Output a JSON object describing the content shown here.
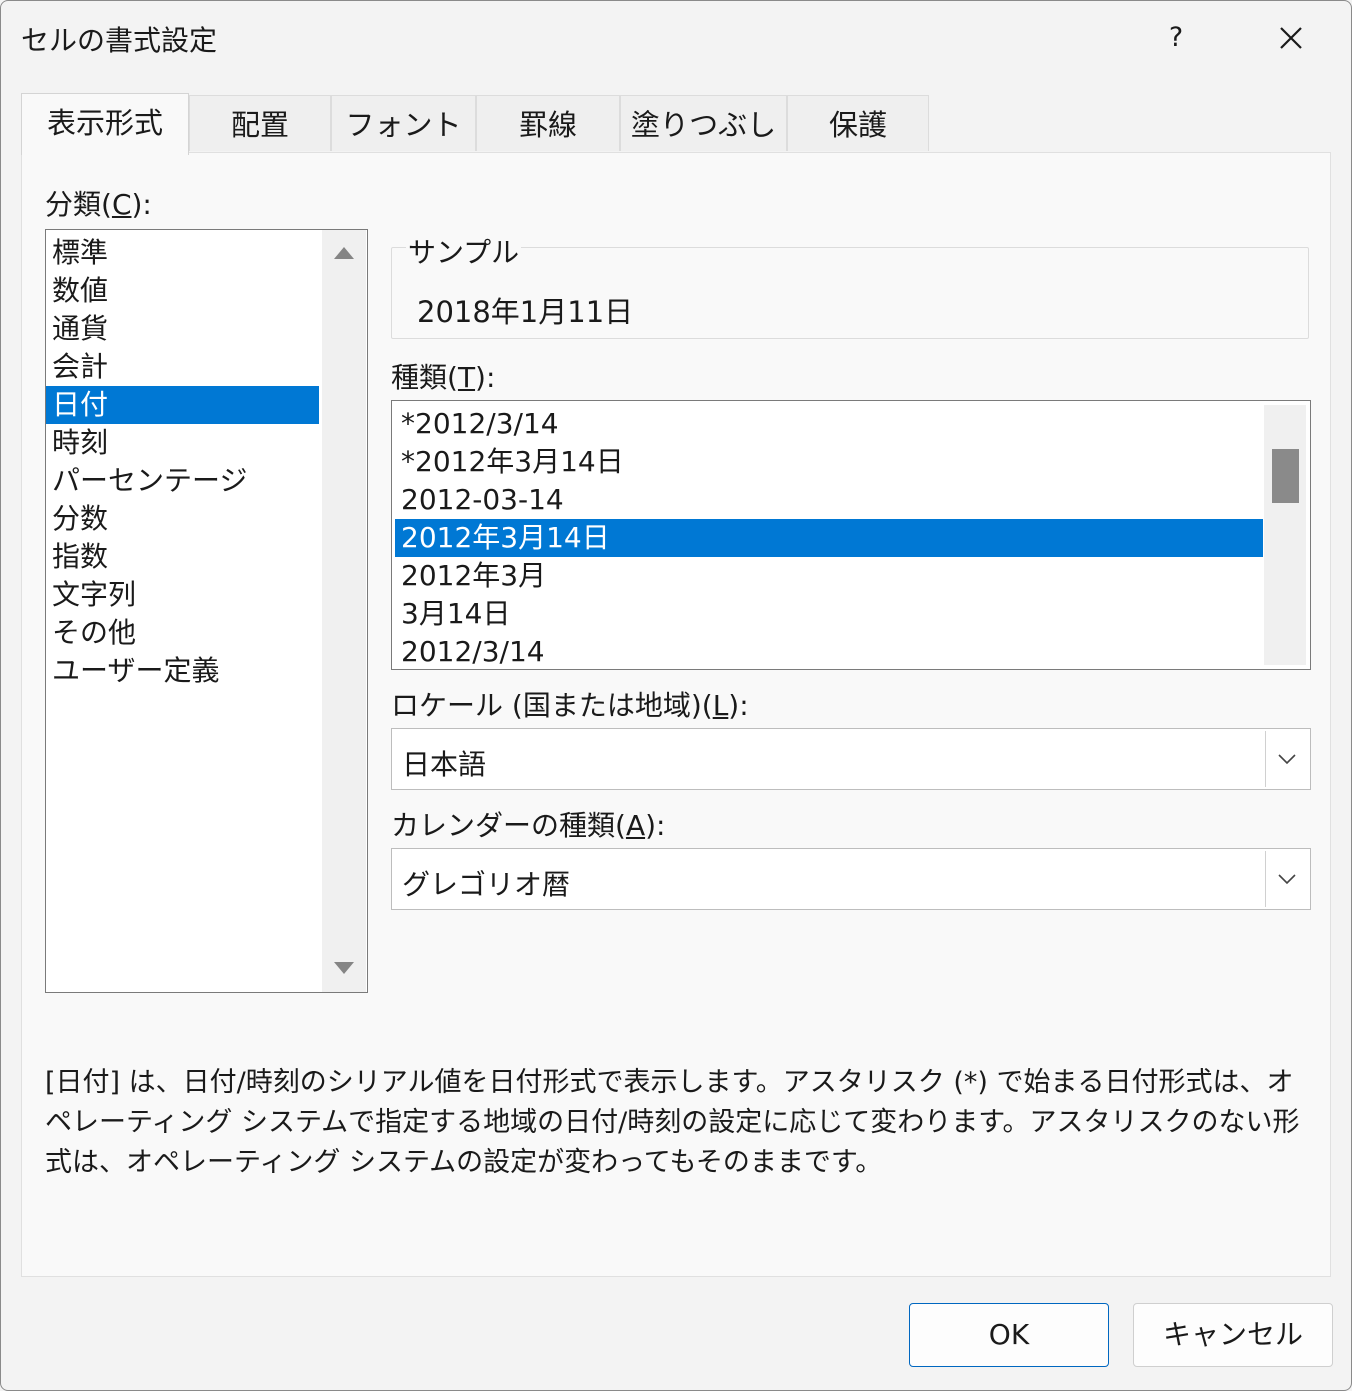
{
  "window": {
    "title": "セルの書式設定",
    "help": "?"
  },
  "tabs": [
    "表示形式",
    "配置",
    "フォント",
    "罫線",
    "塗りつぶし",
    "保護"
  ],
  "category": {
    "label_pre": "分類(",
    "label_key": "C",
    "label_post": "):",
    "items": [
      "標準",
      "数値",
      "通貨",
      "会計",
      "日付",
      "時刻",
      "パーセンテージ",
      "分数",
      "指数",
      "文字列",
      "その他",
      "ユーザー定義"
    ],
    "selected_index": 4
  },
  "sample": {
    "legend": "サンプル",
    "value": "2018年1月11日"
  },
  "type": {
    "label_pre": "種類(",
    "label_key": "T",
    "label_post": "):",
    "items": [
      "*2012/3/14",
      "*2012年3月14日",
      "2012-03-14",
      "2012年3月14日",
      "2012年3月",
      "3月14日",
      "2012/3/14"
    ],
    "selected_index": 3
  },
  "locale": {
    "label_pre": "ロケール (国または地域)(",
    "label_key": "L",
    "label_post": "):",
    "value": "日本語"
  },
  "calendar": {
    "label_pre": "カレンダーの種類(",
    "label_key": "A",
    "label_post": "):",
    "value": "グレゴリオ暦"
  },
  "description": "[日付] は、日付/時刻のシリアル値を日付形式で表示します。アスタリスク (*) で始まる日付形式は、オペレーティング システムで指定する地域の日付/時刻の設定に応じて変わります。アスタリスクのない形式は、オペレーティング システムの設定が変わってもそのままです。",
  "buttons": {
    "ok": "OK",
    "cancel": "キャンセル"
  },
  "colors": {
    "selection": "#0078d4",
    "primary_border": "#0067c0"
  }
}
